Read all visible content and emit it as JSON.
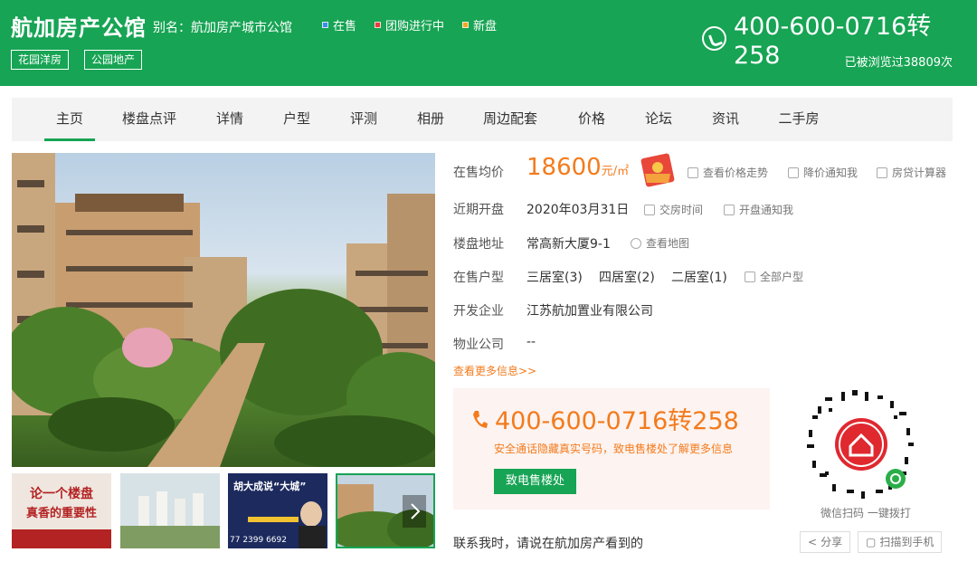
{
  "header": {
    "title": "航加房产公馆",
    "alias": "别名：航加房产城市公馆",
    "statuses": [
      {
        "label": "在售",
        "color": "#3b8ee8"
      },
      {
        "label": "团购进行中",
        "color": "#e83b3b"
      },
      {
        "label": "新盘",
        "color": "#f5a623"
      }
    ],
    "phone": "400-600-0716转258",
    "chips": [
      "花园洋房",
      "公园地产"
    ],
    "views": "已被浏览过38809次"
  },
  "nav": [
    "主页",
    "楼盘点评",
    "详情",
    "户型",
    "评测",
    "相册",
    "周边配套",
    "价格",
    "论坛",
    "资讯",
    "二手房"
  ],
  "info": {
    "price_label": "在售均价",
    "price_value": "18600",
    "price_unit": "元/㎡",
    "price_links": [
      "查看价格走势",
      "降价通知我",
      "房贷计算器"
    ],
    "open_label": "近期开盘",
    "open_value": "2020年03月31日",
    "open_links": [
      "交房时间",
      "开盘通知我"
    ],
    "addr_label": "楼盘地址",
    "addr_value": "常高新大厦9-1",
    "addr_link": "查看地图",
    "type_label": "在售户型",
    "types": [
      "三居室(3)",
      "四居室(2)",
      "二居室(1)"
    ],
    "type_link": "全部户型",
    "dev_label": "开发企业",
    "dev_value": "江苏航加置业有限公司",
    "pm_label": "物业公司",
    "pm_value": "--",
    "more": "查看更多信息>>"
  },
  "call": {
    "phone": "400-600-0716转258",
    "note": "安全通话隐藏真实号码，致电售楼处了解更多信息",
    "button": "致电售楼处"
  },
  "contact": "联系我时，请说在航加房产看到的",
  "qr": {
    "caption": "微信扫码 一键拨打",
    "share": "分享",
    "scan": "扫描到手机"
  },
  "thumbs": {
    "t1_line1": "论一个楼盘",
    "t1_line2": "真香的重要性",
    "t3_text": "胡大成说“大城”",
    "t3_phone": "77 2399 6692"
  },
  "colors": {
    "brand": "#17a454",
    "accent": "#f37b1d"
  }
}
